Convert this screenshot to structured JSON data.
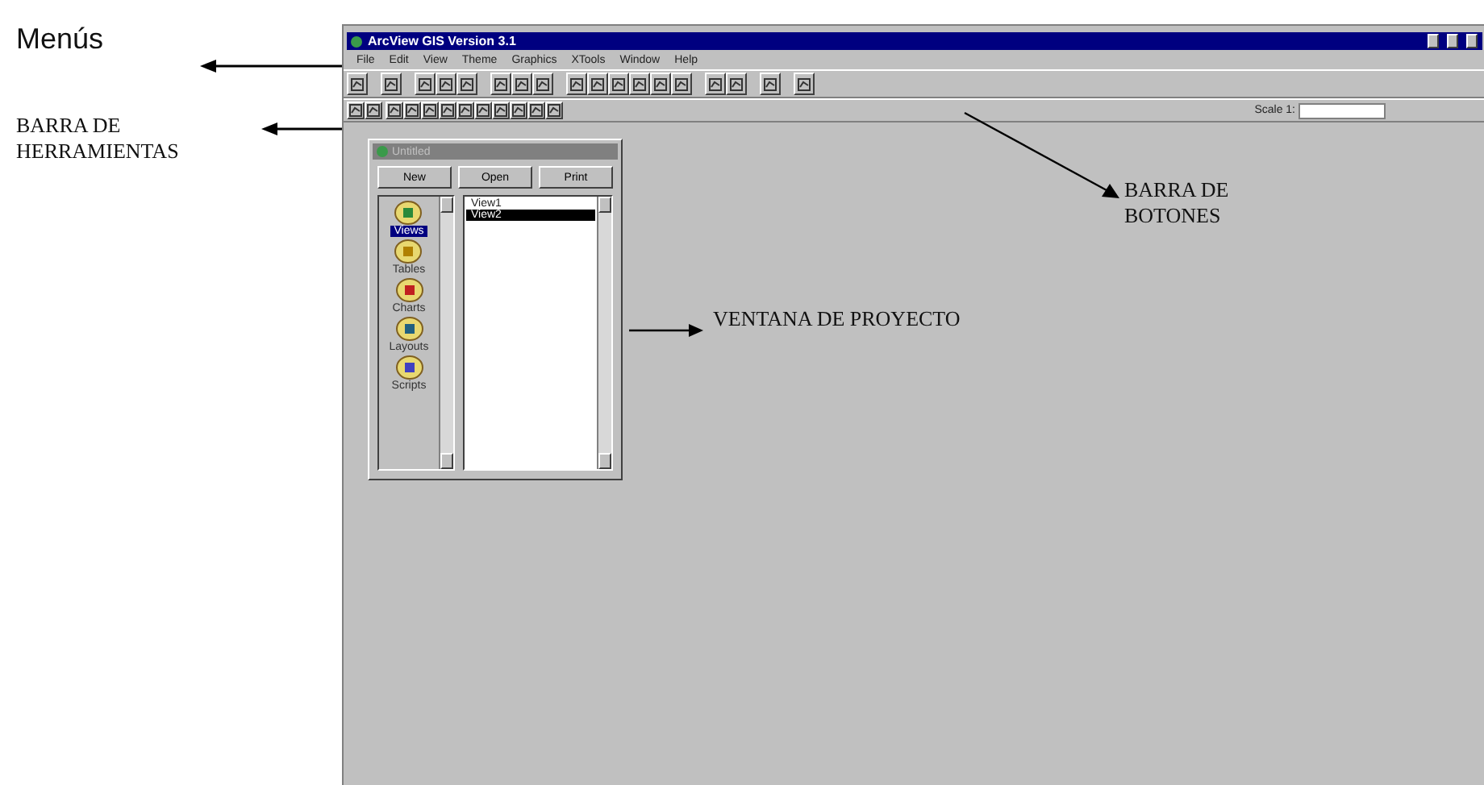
{
  "annotations": {
    "menus": "Menús",
    "tools": "BARRA DE HERRAMIENTAS",
    "buttons": "BARRA DE BOTONES",
    "project": "VENTANA DE PROYECTO"
  },
  "window": {
    "title": "ArcView GIS Version 3.1"
  },
  "menus": [
    "File",
    "Edit",
    "View",
    "Theme",
    "Graphics",
    "XTools",
    "Window",
    "Help"
  ],
  "scale_label": "Scale 1:",
  "project_window": {
    "title": "Untitled",
    "buttons": [
      "New",
      "Open",
      "Print"
    ],
    "doc_types": [
      {
        "label": "Views",
        "selected": true
      },
      {
        "label": "Tables",
        "selected": false
      },
      {
        "label": "Charts",
        "selected": false
      },
      {
        "label": "Layouts",
        "selected": false
      },
      {
        "label": "Scripts",
        "selected": false
      }
    ],
    "documents": [
      {
        "label": "View1",
        "selected": false
      },
      {
        "label": "View2",
        "selected": true
      }
    ]
  }
}
